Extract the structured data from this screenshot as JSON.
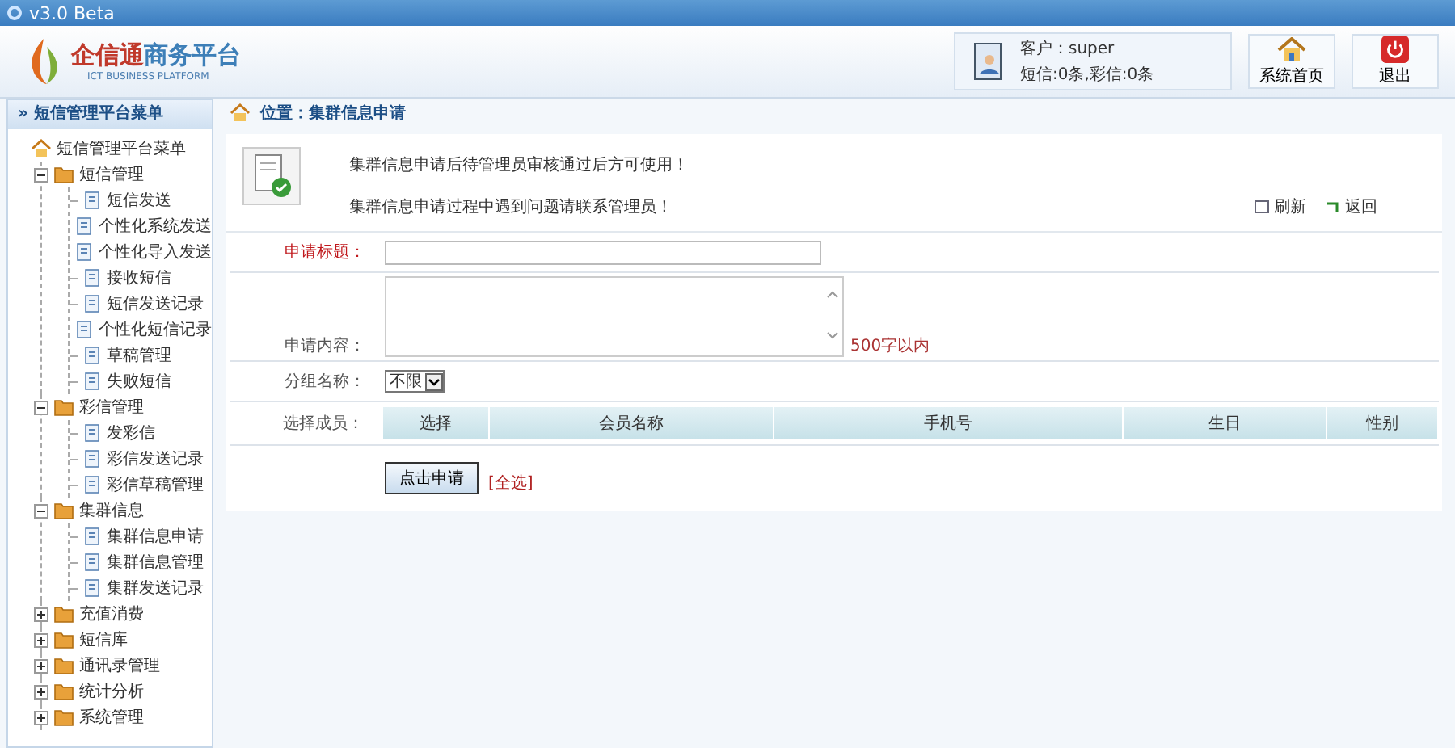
{
  "window": {
    "title": "v3.0  Beta"
  },
  "header": {
    "logo_cn_a": "企信通",
    "logo_cn_b": "商务平台",
    "logo_en": "ICT BUSINESS PLATFORM",
    "user_line": "客户：super",
    "quota_line": "短信:0条,彩信:0条",
    "buttons": [
      {
        "kind": "home",
        "label": "系统首页"
      },
      {
        "kind": "exit",
        "label": "退出"
      }
    ]
  },
  "sidebar": {
    "title": "» 短信管理平台菜单",
    "root": "短信管理平台菜单",
    "items": [
      {
        "label": "短信管理",
        "expanded": true,
        "children": [
          {
            "label": "短信发送"
          },
          {
            "label": "个性化系统发送"
          },
          {
            "label": "个性化导入发送"
          },
          {
            "label": "接收短信"
          },
          {
            "label": "短信发送记录"
          },
          {
            "label": "个性化短信记录"
          },
          {
            "label": "草稿管理"
          },
          {
            "label": "失败短信"
          }
        ]
      },
      {
        "label": "彩信管理",
        "expanded": true,
        "children": [
          {
            "label": "发彩信"
          },
          {
            "label": "彩信发送记录"
          },
          {
            "label": "彩信草稿管理"
          }
        ]
      },
      {
        "label": "集群信息",
        "expanded": true,
        "children": [
          {
            "label": "集群信息申请"
          },
          {
            "label": "集群信息管理"
          },
          {
            "label": "集群发送记录"
          }
        ]
      },
      {
        "label": "充值消费",
        "expanded": false
      },
      {
        "label": "短信库",
        "expanded": false
      },
      {
        "label": "通讯录管理",
        "expanded": false
      },
      {
        "label": "统计分析",
        "expanded": false
      },
      {
        "label": "系统管理",
        "expanded": false
      }
    ]
  },
  "main": {
    "breadcrumb": "位置：集群信息申请",
    "notices": [
      "集群信息申请后待管理员审核通过后方可使用！",
      "集群信息申请过程中遇到问题请联系管理员！"
    ],
    "actions": [
      {
        "kind": "refresh",
        "label": "刷新"
      },
      {
        "kind": "back",
        "label": "返回"
      }
    ],
    "form": [
      {
        "kind": "text",
        "label": "申请标题：",
        "required": true
      },
      {
        "kind": "textarea",
        "label": "申请内容：",
        "required": false,
        "hint": "500字以内"
      },
      {
        "kind": "select",
        "label": "分组名称：",
        "required": false,
        "value": "不限"
      },
      {
        "kind": "table",
        "label": "选择成员：",
        "required": false,
        "columns": [
          "选择",
          "会员名称",
          "手机号",
          "生日",
          "性别"
        ]
      }
    ],
    "submit": "点击申请",
    "select_all": "[全选]"
  }
}
